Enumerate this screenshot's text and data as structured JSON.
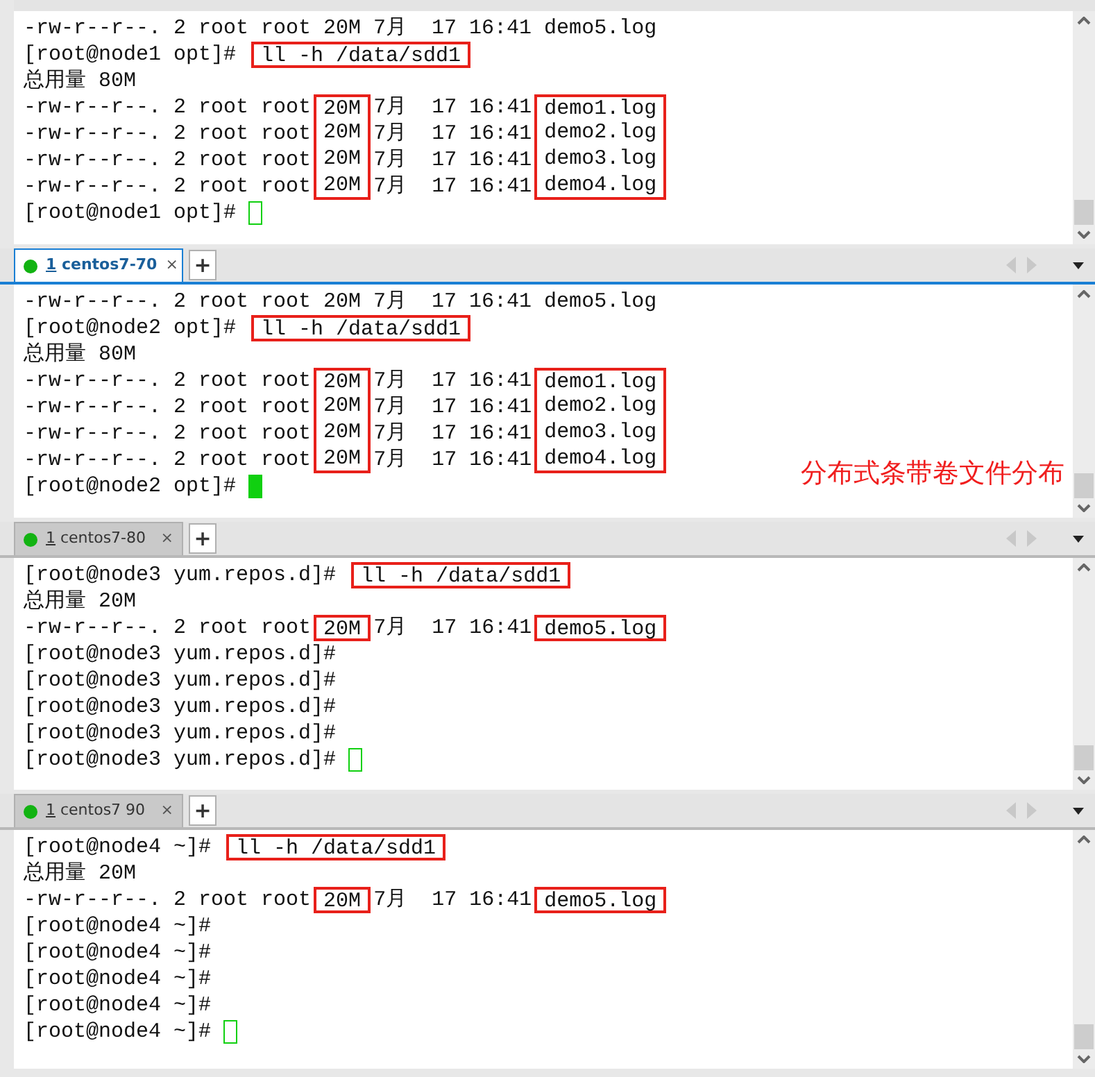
{
  "panes": [
    {
      "lines": [
        {
          "segments": [
            {
              "text": "-rw-r--r--. 2 root root 20M 7月  17 16:41 demo5.log",
              "boxed": false
            }
          ]
        },
        {
          "segments": [
            {
              "text": "[root@node1 opt]# ",
              "boxed": false
            },
            {
              "text": "ll -h /data/sdd1",
              "boxed": true
            }
          ]
        },
        {
          "segments": [
            {
              "text": "总用量 80M",
              "boxed": false
            }
          ]
        },
        {
          "segments": [
            {
              "text": "-rw-r--r--. 2 root root",
              "boxed": false
            },
            {
              "text": "20M",
              "boxed": true
            },
            {
              "text": "7月  17 16:41",
              "boxed": false
            },
            {
              "text": "demo1.log",
              "boxed": true
            }
          ]
        },
        {
          "segments": [
            {
              "text": "-rw-r--r--. 2 root root",
              "boxed": false
            },
            {
              "text": "20M",
              "boxed": true
            },
            {
              "text": "7月  17 16:41",
              "boxed": false
            },
            {
              "text": "demo2.log",
              "boxed": true
            }
          ]
        },
        {
          "segments": [
            {
              "text": "-rw-r--r--. 2 root root",
              "boxed": false
            },
            {
              "text": "20M",
              "boxed": true
            },
            {
              "text": "7月  17 16:41",
              "boxed": false
            },
            {
              "text": "demo3.log",
              "boxed": true
            }
          ]
        },
        {
          "segments": [
            {
              "text": "-rw-r--r--. 2 root root",
              "boxed": false
            },
            {
              "text": "20M",
              "boxed": true
            },
            {
              "text": "7月  17 16:41",
              "boxed": false
            },
            {
              "text": "demo4.log",
              "boxed": true
            }
          ]
        },
        {
          "segments": [
            {
              "text": "[root@node1 opt]# ",
              "boxed": false
            }
          ]
        }
      ],
      "cursor": {
        "solid": false
      }
    },
    {
      "tab": {
        "number": "1",
        "label": "centos7-70",
        "close": "×",
        "selected": true
      },
      "new_tab": "+",
      "lines": [
        {
          "segments": [
            {
              "text": "-rw-r--r--. 2 root root 20M 7月  17 16:41 demo5.log",
              "boxed": false
            }
          ]
        },
        {
          "segments": [
            {
              "text": "[root@node2 opt]# ",
              "boxed": false
            },
            {
              "text": "ll -h /data/sdd1",
              "boxed": true
            }
          ]
        },
        {
          "segments": [
            {
              "text": "总用量 80M",
              "boxed": false
            }
          ]
        },
        {
          "segments": [
            {
              "text": "-rw-r--r--. 2 root root",
              "boxed": false
            },
            {
              "text": "20M",
              "boxed": true
            },
            {
              "text": "7月  17 16:41",
              "boxed": false
            },
            {
              "text": "demo1.log",
              "boxed": true
            }
          ]
        },
        {
          "segments": [
            {
              "text": "-rw-r--r--. 2 root root",
              "boxed": false
            },
            {
              "text": "20M",
              "boxed": true
            },
            {
              "text": "7月  17 16:41",
              "boxed": false
            },
            {
              "text": "demo2.log",
              "boxed": true
            }
          ]
        },
        {
          "segments": [
            {
              "text": "-rw-r--r--. 2 root root",
              "boxed": false
            },
            {
              "text": "20M",
              "boxed": true
            },
            {
              "text": "7月  17 16:41",
              "boxed": false
            },
            {
              "text": "demo3.log",
              "boxed": true
            }
          ]
        },
        {
          "segments": [
            {
              "text": "-rw-r--r--. 2 root root",
              "boxed": false
            },
            {
              "text": "20M",
              "boxed": true
            },
            {
              "text": "7月  17 16:41",
              "boxed": false
            },
            {
              "text": "demo4.log",
              "boxed": true
            }
          ]
        },
        {
          "segments": [
            {
              "text": "[root@node2 opt]# ",
              "boxed": false
            }
          ]
        }
      ],
      "cursor": {
        "solid": true
      },
      "annotation": "分布式条带卷文件分布"
    },
    {
      "tab": {
        "number": "1",
        "label": "centos7-80",
        "close": "×",
        "selected": false
      },
      "new_tab": "+",
      "lines": [
        {
          "segments": [
            {
              "text": "[root@node3 yum.repos.d]# ",
              "boxed": false
            },
            {
              "text": "ll -h /data/sdd1",
              "boxed": true
            }
          ]
        },
        {
          "segments": [
            {
              "text": "总用量 20M",
              "boxed": false
            }
          ]
        },
        {
          "segments": [
            {
              "text": "-rw-r--r--. 2 root root",
              "boxed": false
            },
            {
              "text": "20M",
              "boxed": true
            },
            {
              "text": "7月  17 16:41",
              "boxed": false
            },
            {
              "text": "demo5.log",
              "boxed": true
            }
          ]
        },
        {
          "segments": [
            {
              "text": "[root@node3 yum.repos.d]#",
              "boxed": false
            }
          ]
        },
        {
          "segments": [
            {
              "text": "[root@node3 yum.repos.d]#",
              "boxed": false
            }
          ]
        },
        {
          "segments": [
            {
              "text": "[root@node3 yum.repos.d]#",
              "boxed": false
            }
          ]
        },
        {
          "segments": [
            {
              "text": "[root@node3 yum.repos.d]#",
              "boxed": false
            }
          ]
        },
        {
          "segments": [
            {
              "text": "[root@node3 yum.repos.d]# ",
              "boxed": false
            }
          ]
        }
      ],
      "cursor": {
        "solid": false
      }
    },
    {
      "tab": {
        "number": "1",
        "label": "centos7 90",
        "close": "×",
        "selected": false
      },
      "new_tab": "+",
      "lines": [
        {
          "segments": [
            {
              "text": "[root@node4 ~]# ",
              "boxed": false
            },
            {
              "text": "ll -h /data/sdd1",
              "boxed": true
            }
          ]
        },
        {
          "segments": [
            {
              "text": "总用量 20M",
              "boxed": false
            }
          ]
        },
        {
          "segments": [
            {
              "text": "-rw-r--r--. 2 root root",
              "boxed": false
            },
            {
              "text": "20M",
              "boxed": true
            },
            {
              "text": "7月  17 16:41",
              "boxed": false
            },
            {
              "text": "demo5.log",
              "boxed": true
            }
          ]
        },
        {
          "segments": [
            {
              "text": "[root@node4 ~]#",
              "boxed": false
            }
          ]
        },
        {
          "segments": [
            {
              "text": "[root@node4 ~]#",
              "boxed": false
            }
          ]
        },
        {
          "segments": [
            {
              "text": "[root@node4 ~]#",
              "boxed": false
            }
          ]
        },
        {
          "segments": [
            {
              "text": "[root@node4 ~]#",
              "boxed": false
            }
          ]
        },
        {
          "segments": [
            {
              "text": "[root@node4 ~]# ",
              "boxed": false
            }
          ]
        }
      ],
      "cursor": {
        "solid": false
      }
    }
  ]
}
